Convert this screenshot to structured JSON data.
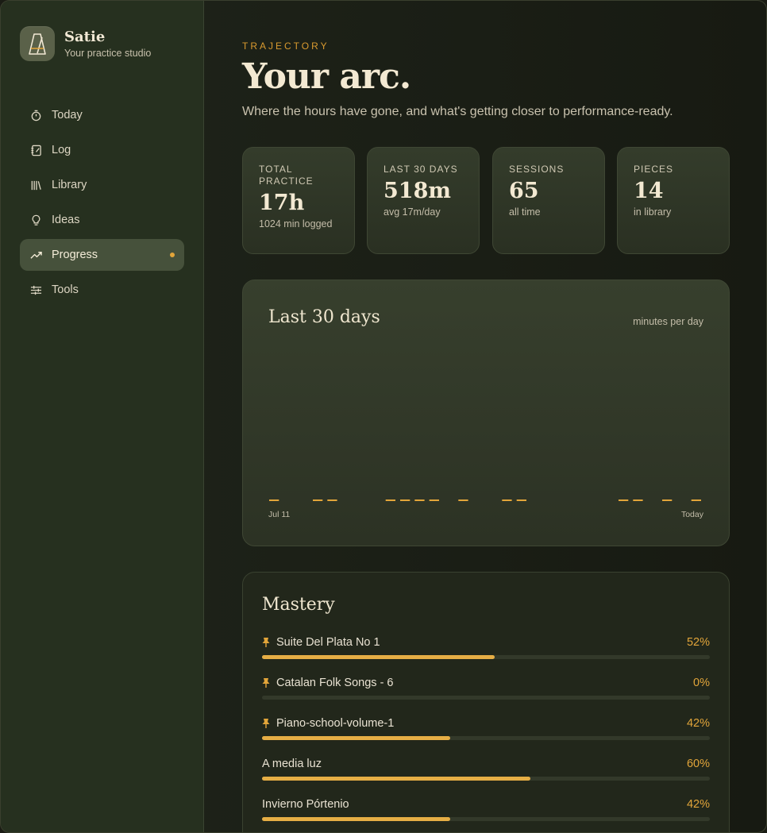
{
  "brand": {
    "name": "Satie",
    "subtitle": "Your practice studio"
  },
  "nav": [
    {
      "label": "Today",
      "icon": "stopwatch-icon",
      "active": false
    },
    {
      "label": "Log",
      "icon": "notebook-icon",
      "active": false
    },
    {
      "label": "Library",
      "icon": "library-icon",
      "active": false
    },
    {
      "label": "Ideas",
      "icon": "lightbulb-icon",
      "active": false
    },
    {
      "label": "Progress",
      "icon": "trending-up-icon",
      "active": true
    },
    {
      "label": "Tools",
      "icon": "sliders-icon",
      "active": false
    }
  ],
  "header": {
    "eyebrow": "TRAJECTORY",
    "title": "Your arc.",
    "subtitle": "Where the hours have gone, and what's getting closer to performance-ready."
  },
  "stats": [
    {
      "label": "TOTAL PRACTICE",
      "value": "17h",
      "note": "1024 min logged"
    },
    {
      "label": "LAST 30 DAYS",
      "value": "518m",
      "note": "avg 17m/day"
    },
    {
      "label": "SESSIONS",
      "value": "65",
      "note": "all time"
    },
    {
      "label": "PIECES",
      "value": "14",
      "note": "in library"
    }
  ],
  "chart": {
    "title": "Last 30 days",
    "unit_label": "minutes per day",
    "x_start_label": "Jul 11",
    "x_end_label": "Today"
  },
  "chart_data": {
    "type": "bar",
    "title": "Last 30 days",
    "ylabel": "minutes per day",
    "x_tick_labels": [
      "Jul 11",
      "Today"
    ],
    "active_day_indices": [
      0,
      3,
      4,
      8,
      9,
      10,
      11,
      13,
      16,
      17,
      24,
      25,
      27,
      29
    ],
    "color": "#e2a53a"
  },
  "mastery": {
    "title": "Mastery",
    "items": [
      {
        "name": "Suite Del Plata No 1",
        "pinned": true,
        "percent_label": "52%",
        "fraction": 0.52
      },
      {
        "name": "Catalan Folk Songs - 6",
        "pinned": true,
        "percent_label": "0%",
        "fraction": 0.0
      },
      {
        "name": "Piano-school-volume-1",
        "pinned": true,
        "percent_label": "42%",
        "fraction": 0.42
      },
      {
        "name": "A media luz",
        "pinned": false,
        "percent_label": "60%",
        "fraction": 0.6
      },
      {
        "name": "Invierno Pórtenio",
        "pinned": false,
        "percent_label": "42%",
        "fraction": 0.42
      }
    ]
  },
  "colors": {
    "accent": "#e2a53a",
    "sidebar": "#26301f",
    "active_nav": "#46513b"
  }
}
